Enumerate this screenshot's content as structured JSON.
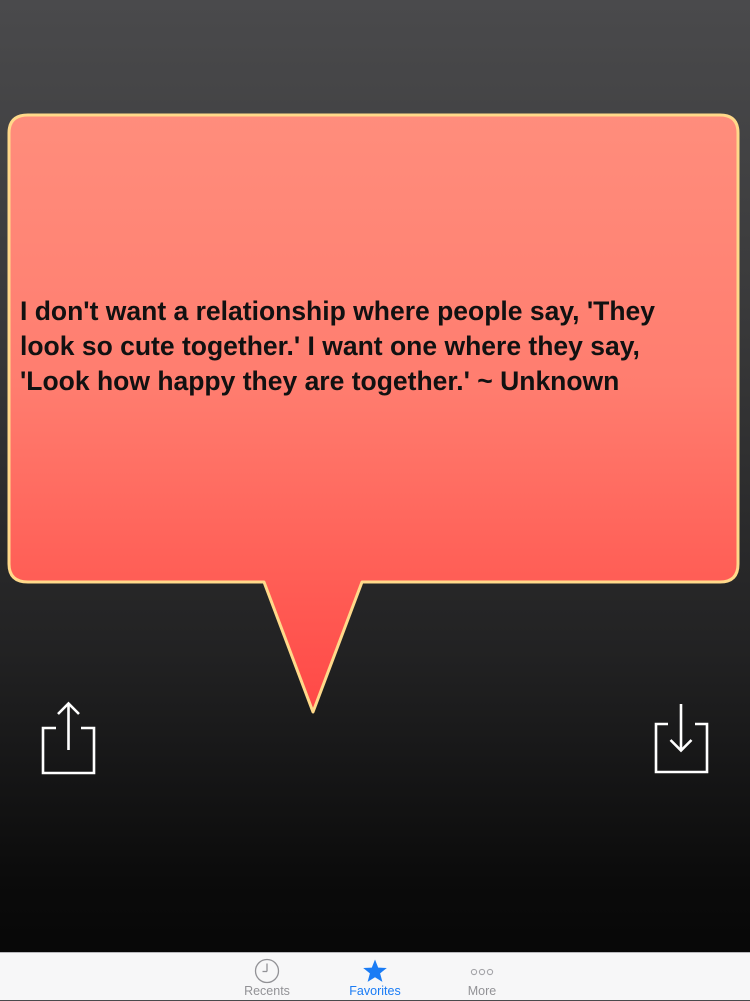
{
  "quote": {
    "text": "I don't want a relationship where people say, 'They look so cute together.' I want one where they say, 'Look how happy they are together.' ~ Unknown",
    "lines": [
      "I don't want a relationship where people say, 'They",
      "look so cute together.' I want one where they say,",
      "'Look how happy they are together.' ~ Unknown"
    ]
  },
  "actions": {
    "share_icon": "share-icon",
    "save_icon": "download-icon"
  },
  "tabbar": {
    "tabs": [
      {
        "label": "Recents",
        "icon": "clock-icon",
        "active": false
      },
      {
        "label": "Favorites",
        "icon": "star-icon",
        "active": true
      },
      {
        "label": "More",
        "icon": "more-dots-icon",
        "active": false
      }
    ]
  },
  "colors": {
    "bubble_top": "#ff8a7a",
    "bubble_bottom": "#ff4f4a",
    "bubble_border": "#ffd98a",
    "tab_active": "#1a7cf5",
    "tab_inactive": "#929296"
  }
}
